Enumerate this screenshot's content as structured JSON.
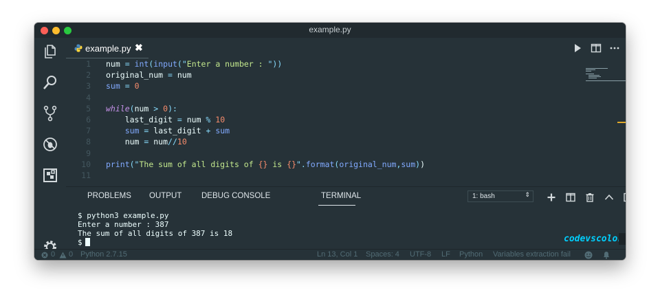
{
  "window": {
    "title": "example.py"
  },
  "tab": {
    "label": "example.py",
    "close": "✖"
  },
  "editor": {
    "lines": [
      {
        "n": "1",
        "tokens": [
          {
            "t": "num ",
            "c": "text"
          },
          {
            "t": "=",
            "c": "op"
          },
          {
            "t": " ",
            "c": "text"
          },
          {
            "t": "int",
            "c": "fn"
          },
          {
            "t": "(",
            "c": "op"
          },
          {
            "t": "input",
            "c": "fn"
          },
          {
            "t": "(\"",
            "c": "op"
          },
          {
            "t": "Enter a number : ",
            "c": "str"
          },
          {
            "t": "\"))",
            "c": "op"
          }
        ]
      },
      {
        "n": "2",
        "tokens": [
          {
            "t": "original_num ",
            "c": "text"
          },
          {
            "t": "=",
            "c": "op"
          },
          {
            "t": " num",
            "c": "text"
          }
        ]
      },
      {
        "n": "3",
        "tokens": [
          {
            "t": "sum",
            "c": "var"
          },
          {
            "t": " ",
            "c": "text"
          },
          {
            "t": "=",
            "c": "op"
          },
          {
            "t": " ",
            "c": "text"
          },
          {
            "t": "0",
            "c": "num"
          }
        ]
      },
      {
        "n": "4",
        "tokens": []
      },
      {
        "n": "5",
        "tokens": [
          {
            "t": "while",
            "c": "kw"
          },
          {
            "t": "(",
            "c": "op"
          },
          {
            "t": "num ",
            "c": "text"
          },
          {
            "t": ">",
            "c": "op"
          },
          {
            "t": " ",
            "c": "text"
          },
          {
            "t": "0",
            "c": "num"
          },
          {
            "t": "):",
            "c": "op"
          }
        ]
      },
      {
        "n": "6",
        "tokens": [
          {
            "t": "    last_digit ",
            "c": "text"
          },
          {
            "t": "=",
            "c": "op"
          },
          {
            "t": " num ",
            "c": "text"
          },
          {
            "t": "%",
            "c": "op"
          },
          {
            "t": " ",
            "c": "text"
          },
          {
            "t": "10",
            "c": "num"
          }
        ]
      },
      {
        "n": "7",
        "tokens": [
          {
            "t": "    ",
            "c": "text"
          },
          {
            "t": "sum",
            "c": "var"
          },
          {
            "t": " ",
            "c": "text"
          },
          {
            "t": "=",
            "c": "op"
          },
          {
            "t": " last_digit ",
            "c": "text"
          },
          {
            "t": "+",
            "c": "op"
          },
          {
            "t": " ",
            "c": "text"
          },
          {
            "t": "sum",
            "c": "var"
          }
        ]
      },
      {
        "n": "8",
        "tokens": [
          {
            "t": "    num ",
            "c": "text"
          },
          {
            "t": "=",
            "c": "op"
          },
          {
            "t": " num",
            "c": "text"
          },
          {
            "t": "//",
            "c": "op"
          },
          {
            "t": "10",
            "c": "num"
          }
        ]
      },
      {
        "n": "9",
        "tokens": []
      },
      {
        "n": "10",
        "tokens": [
          {
            "t": "print",
            "c": "fn"
          },
          {
            "t": "(\"",
            "c": "op"
          },
          {
            "t": "The sum of all digits of ",
            "c": "str"
          },
          {
            "t": "{}",
            "c": "fmt"
          },
          {
            "t": " is ",
            "c": "str"
          },
          {
            "t": "{}",
            "c": "fmt"
          },
          {
            "t": "\".",
            "c": "op"
          },
          {
            "t": "format",
            "c": "fn"
          },
          {
            "t": "(",
            "c": "op"
          },
          {
            "t": "original_num",
            "c": "var"
          },
          {
            "t": ",",
            "c": "op"
          },
          {
            "t": "sum",
            "c": "var"
          },
          {
            "t": ")",
            "c": "op"
          },
          {
            "t": ")",
            "c": "text"
          }
        ]
      },
      {
        "n": "11",
        "tokens": []
      }
    ]
  },
  "panel": {
    "tabs": [
      "PROBLEMS",
      "OUTPUT",
      "DEBUG CONSOLE",
      "TERMINAL"
    ],
    "active_tab": "TERMINAL",
    "shell_select": "1: bash"
  },
  "terminal": {
    "lines": [
      "$ python3 example.py",
      "Enter a number : 387",
      "The sum of all digits of 387 is 18",
      "$ "
    ],
    "watermark": "codevscolor.com"
  },
  "statusbar": {
    "errors": "0",
    "warnings": "0",
    "interpreter": "Python 2.7.15",
    "position": "Ln 13, Col 1",
    "spaces": "Spaces: 4",
    "encoding": "UTF-8",
    "eol": "LF",
    "language": "Python",
    "message": "Variables extraction fail"
  },
  "colors": {
    "background": "#263238",
    "accent": "#00d0ff",
    "string": "#c3e88d",
    "number": "#f78c6c",
    "function": "#82aaff",
    "keyword": "#c792ea",
    "operator": "#89ddff"
  }
}
